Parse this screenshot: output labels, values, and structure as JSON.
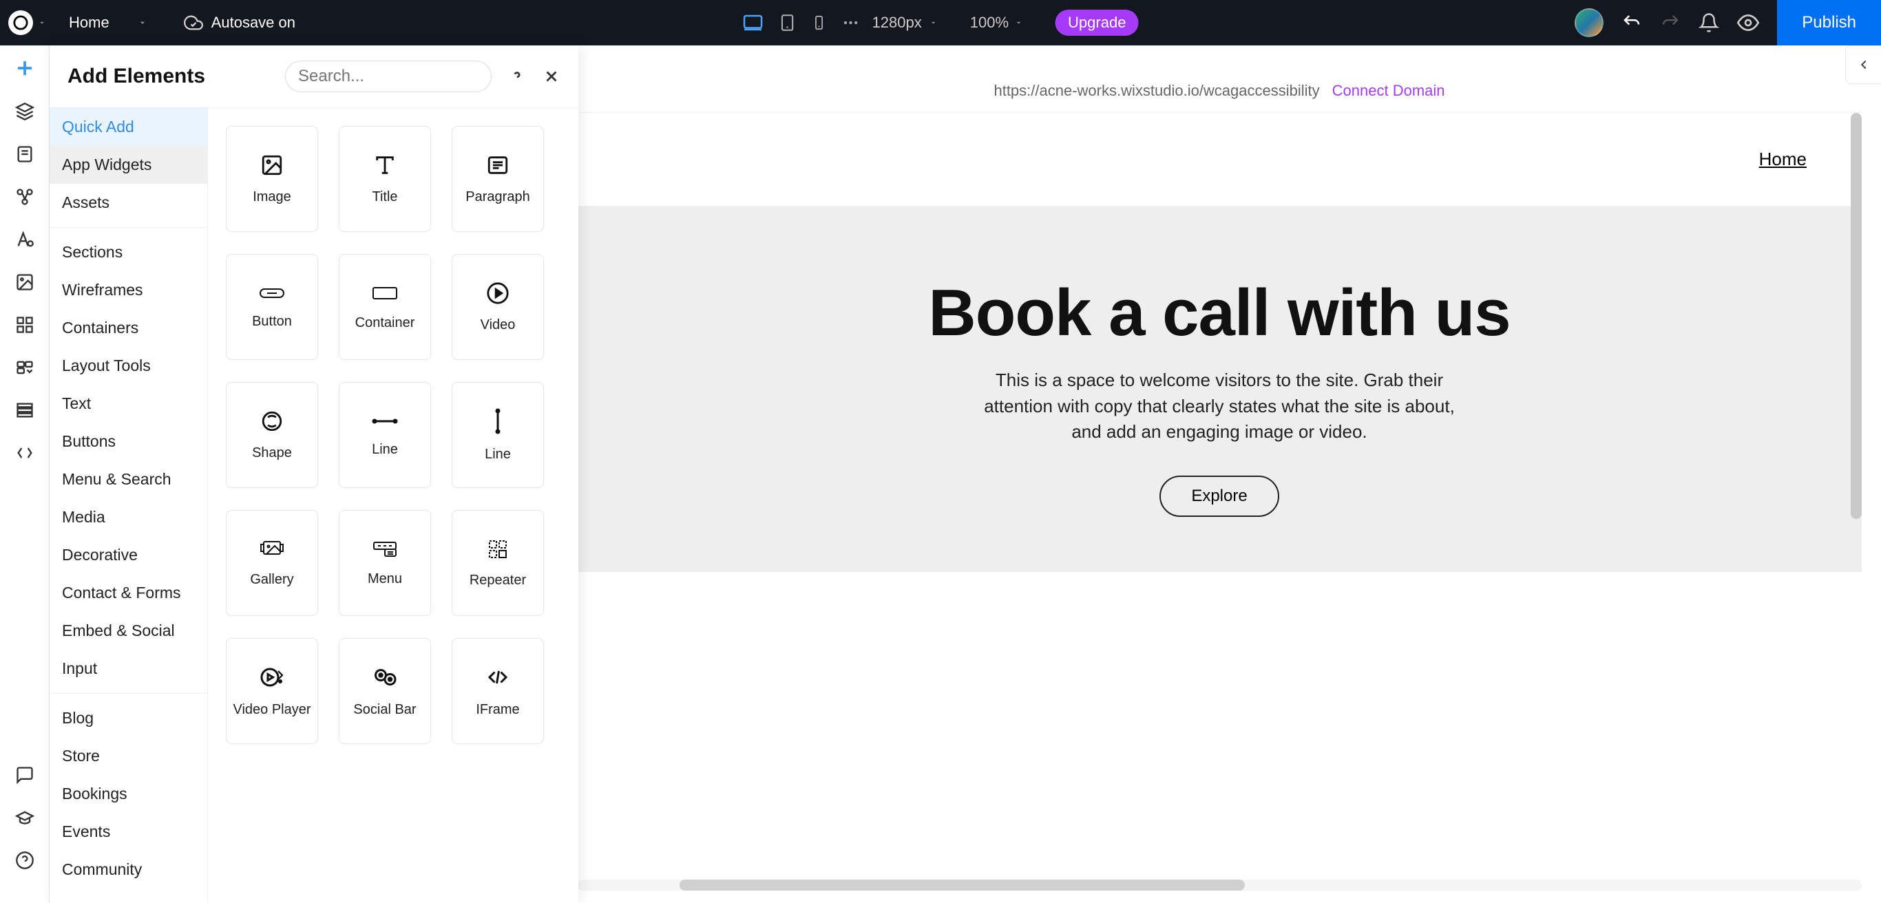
{
  "topbar": {
    "page_name": "Home",
    "autosave": "Autosave on",
    "viewport": "1280px",
    "zoom": "100%",
    "upgrade": "Upgrade",
    "publish": "Publish"
  },
  "panel": {
    "title": "Add Elements",
    "search_placeholder": "Search..."
  },
  "categories": {
    "quick_add": "Quick Add",
    "app_widgets": "App Widgets",
    "assets": "Assets",
    "sections": "Sections",
    "wireframes": "Wireframes",
    "containers": "Containers",
    "layout_tools": "Layout Tools",
    "text": "Text",
    "buttons": "Buttons",
    "menu_search": "Menu & Search",
    "media": "Media",
    "decorative": "Decorative",
    "contact_forms": "Contact & Forms",
    "embed_social": "Embed & Social",
    "input": "Input",
    "blog": "Blog",
    "store": "Store",
    "bookings": "Bookings",
    "events": "Events",
    "community": "Community"
  },
  "elements": {
    "image": "Image",
    "title": "Title",
    "paragraph": "Paragraph",
    "button": "Button",
    "container": "Container",
    "video": "Video",
    "shape": "Shape",
    "line": "Line",
    "line2": "Line",
    "gallery": "Gallery",
    "menu": "Menu",
    "repeater": "Repeater",
    "video_player": "Video Player",
    "social_bar": "Social Bar",
    "iframe": "IFrame"
  },
  "site": {
    "url": "https://acne-works.wixstudio.io/wcagaccessibility",
    "connect": "Connect Domain",
    "nav_home": "Home",
    "hero_title": "Book a call with us",
    "hero_sub": "This is a space to welcome visitors to the site. Grab their attention with copy that clearly states what the site is about, and add an engaging image or video.",
    "hero_cta": "Explore"
  }
}
